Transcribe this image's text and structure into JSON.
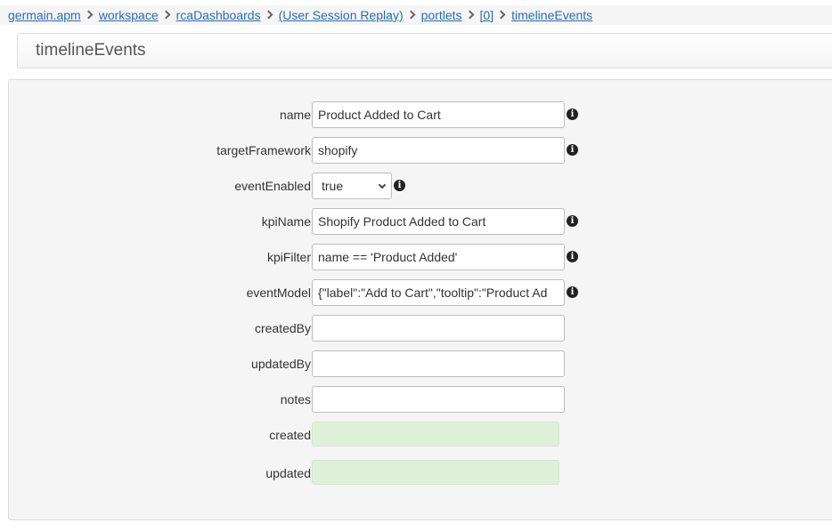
{
  "breadcrumb": {
    "items": [
      "germain.apm",
      "workspace",
      "rcaDashboards",
      "(User Session Replay)",
      "portlets",
      "[0]",
      "timelineEvents"
    ]
  },
  "page": {
    "title": "timelineEvents"
  },
  "form": {
    "name": {
      "label": "name",
      "value": "Product Added to Cart"
    },
    "targetFramework": {
      "label": "targetFramework",
      "value": "shopify"
    },
    "eventEnabled": {
      "label": "eventEnabled",
      "value": "true"
    },
    "kpiName": {
      "label": "kpiName",
      "value": "Shopify Product Added to Cart"
    },
    "kpiFilter": {
      "label": "kpiFilter",
      "value": "name == 'Product Added'"
    },
    "eventModel": {
      "label": "eventModel",
      "value": "{\"label\":\"Add to Cart\",\"tooltip\":\"Product Ad"
    },
    "createdBy": {
      "label": "createdBy",
      "value": ""
    },
    "updatedBy": {
      "label": "updatedBy",
      "value": ""
    },
    "notes": {
      "label": "notes",
      "value": ""
    },
    "created": {
      "label": "created",
      "value": ""
    },
    "updated": {
      "label": "updated",
      "value": ""
    }
  },
  "icons": {
    "info": "info-icon",
    "separator": "chevron-right-icon",
    "dropdown": "chevron-down-icon"
  },
  "info_glyph": "i",
  "colors": {
    "link": "#2a6db6",
    "readonly_bg": "#dff0d8",
    "panel_bg": "#f5f5f5"
  }
}
